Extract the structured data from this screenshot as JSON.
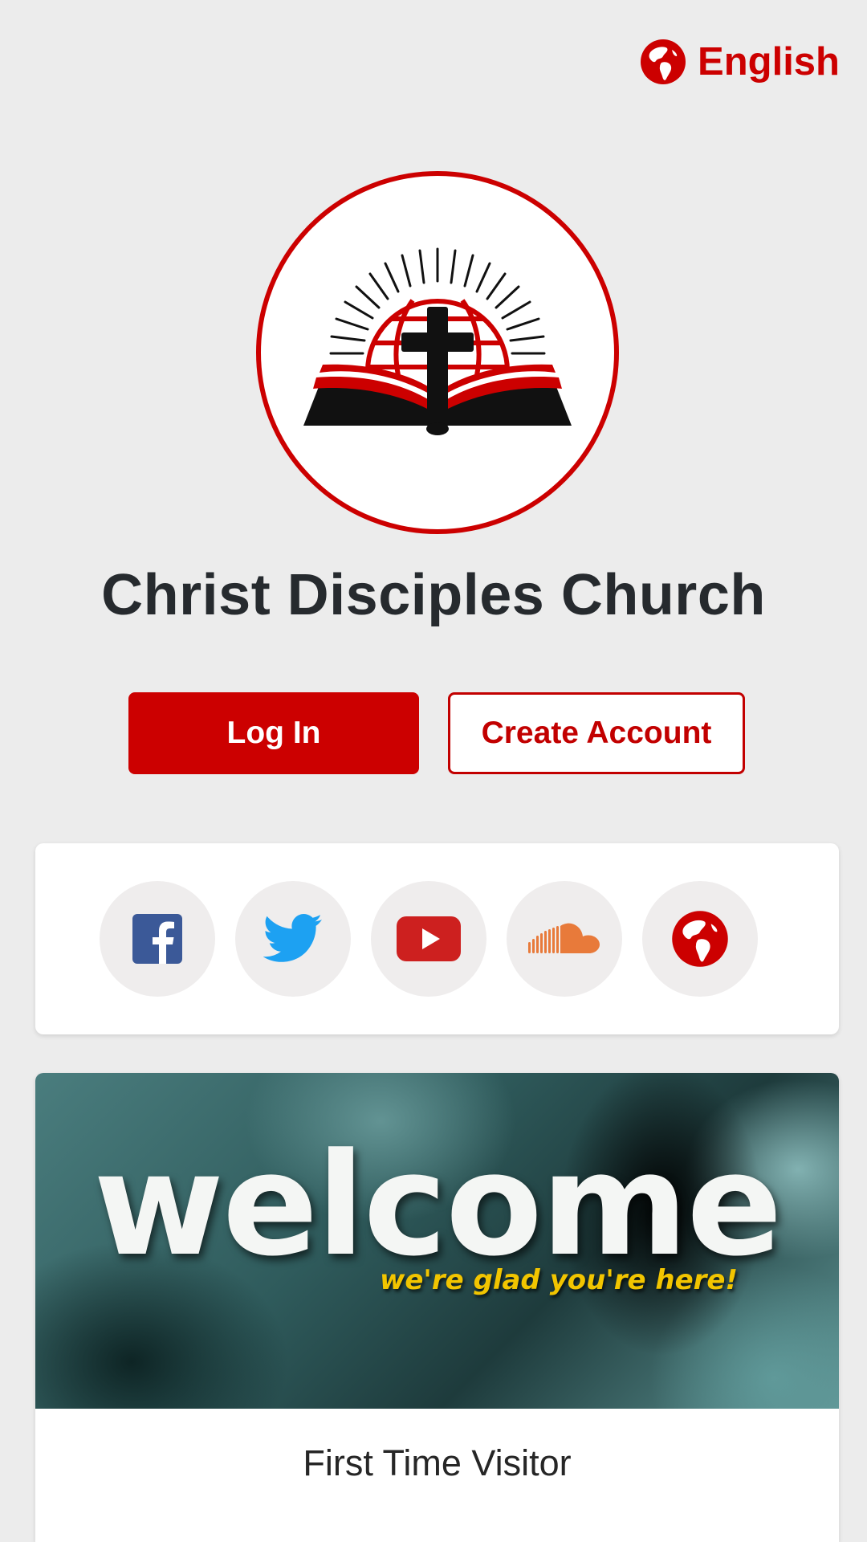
{
  "language": {
    "label": "English",
    "icon": "globe-icon",
    "color": "#cc0000"
  },
  "logo": {
    "icon": "church-logo-book-globe-cross"
  },
  "title": "Christ Disciples Church",
  "actions": {
    "login_label": "Log In",
    "create_account_label": "Create Account"
  },
  "social": [
    {
      "name": "facebook",
      "icon": "facebook-icon",
      "color": "#3b5998"
    },
    {
      "name": "twitter",
      "icon": "twitter-icon",
      "color": "#1da1f2"
    },
    {
      "name": "youtube",
      "icon": "youtube-icon",
      "color": "#cd201f"
    },
    {
      "name": "soundcloud",
      "icon": "soundcloud-icon",
      "color": "#e87a3a"
    },
    {
      "name": "website",
      "icon": "globe-icon",
      "color": "#cc0000"
    }
  ],
  "welcome": {
    "headline": "welcome",
    "subtext": "we're glad you're here!",
    "label": "First Time Visitor"
  }
}
